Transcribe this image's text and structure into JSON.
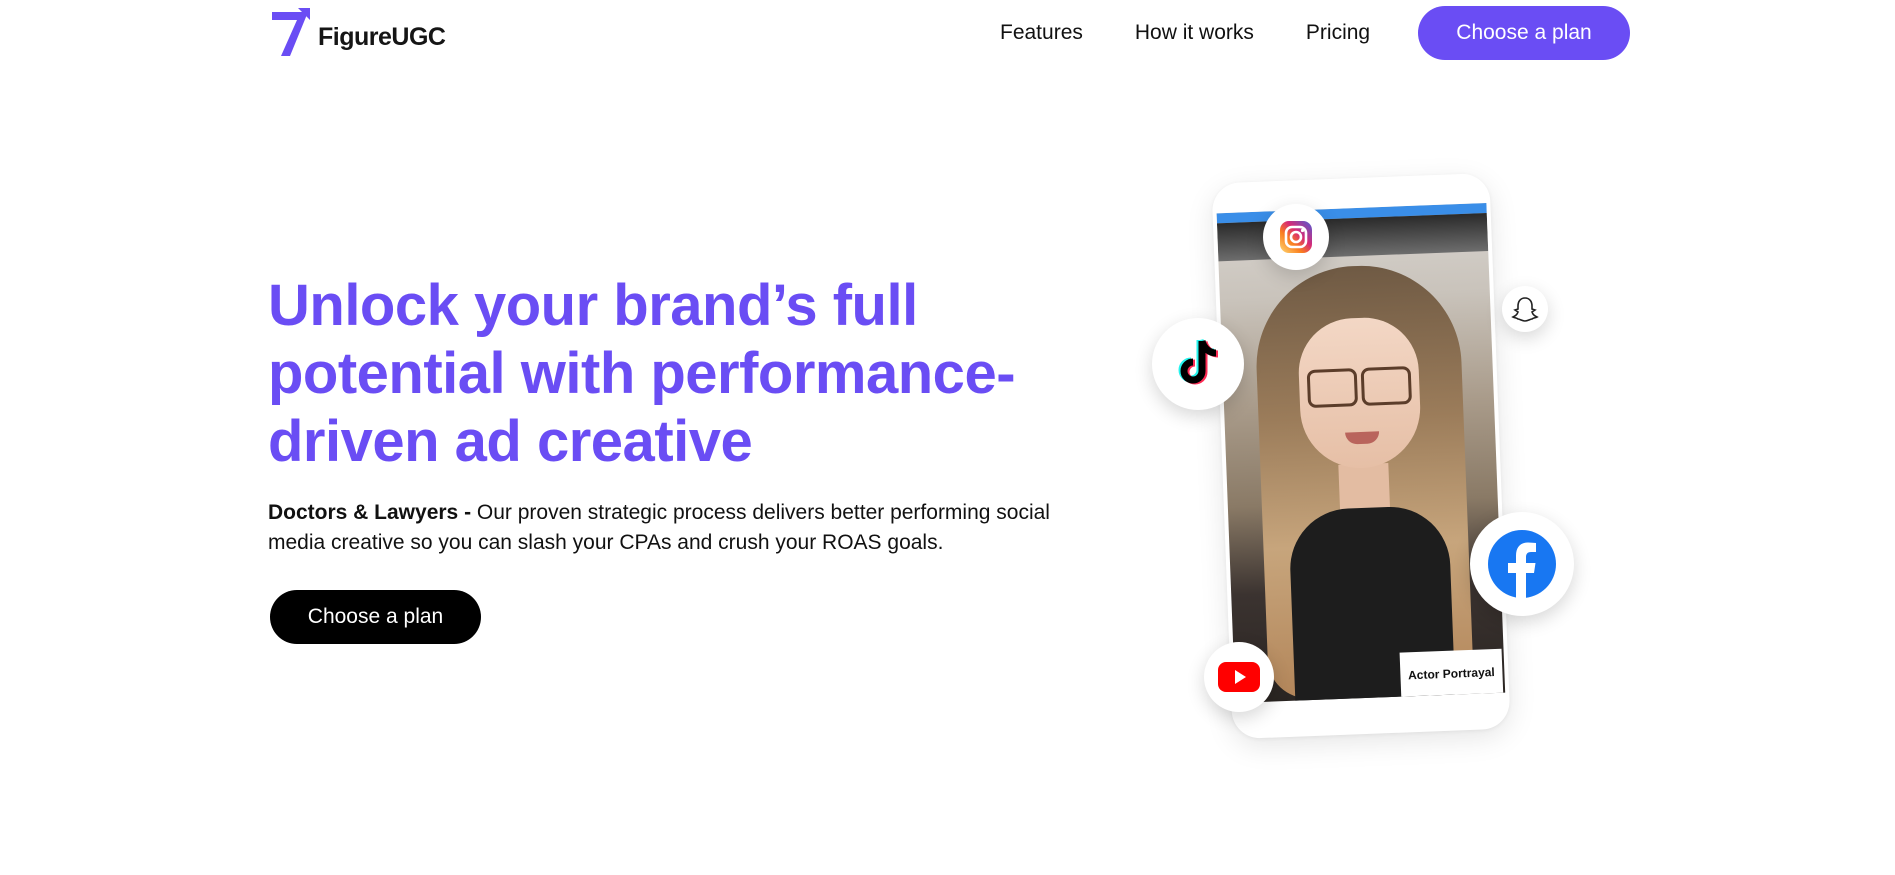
{
  "brand": {
    "name": "FigureUGC",
    "accent_color": "#6a4df4"
  },
  "nav": {
    "items": [
      {
        "label": "Features"
      },
      {
        "label": "How it works"
      },
      {
        "label": "Pricing"
      }
    ],
    "cta_label": "Choose a plan"
  },
  "hero": {
    "title": "Unlock your brand’s full potential with performance-driven ad creative",
    "desc_bold": "Doctors & Lawyers -",
    "desc_text": " Our proven strategic process delivers better performing social media creative so you can slash your CPAs and crush your ROAS goals.",
    "cta_label": "Choose a plan"
  },
  "phone": {
    "overlay_label": "Actor Portrayal"
  },
  "social_icons": [
    "instagram-icon",
    "tiktok-icon",
    "snapchat-icon",
    "facebook-icon",
    "youtube-icon"
  ]
}
